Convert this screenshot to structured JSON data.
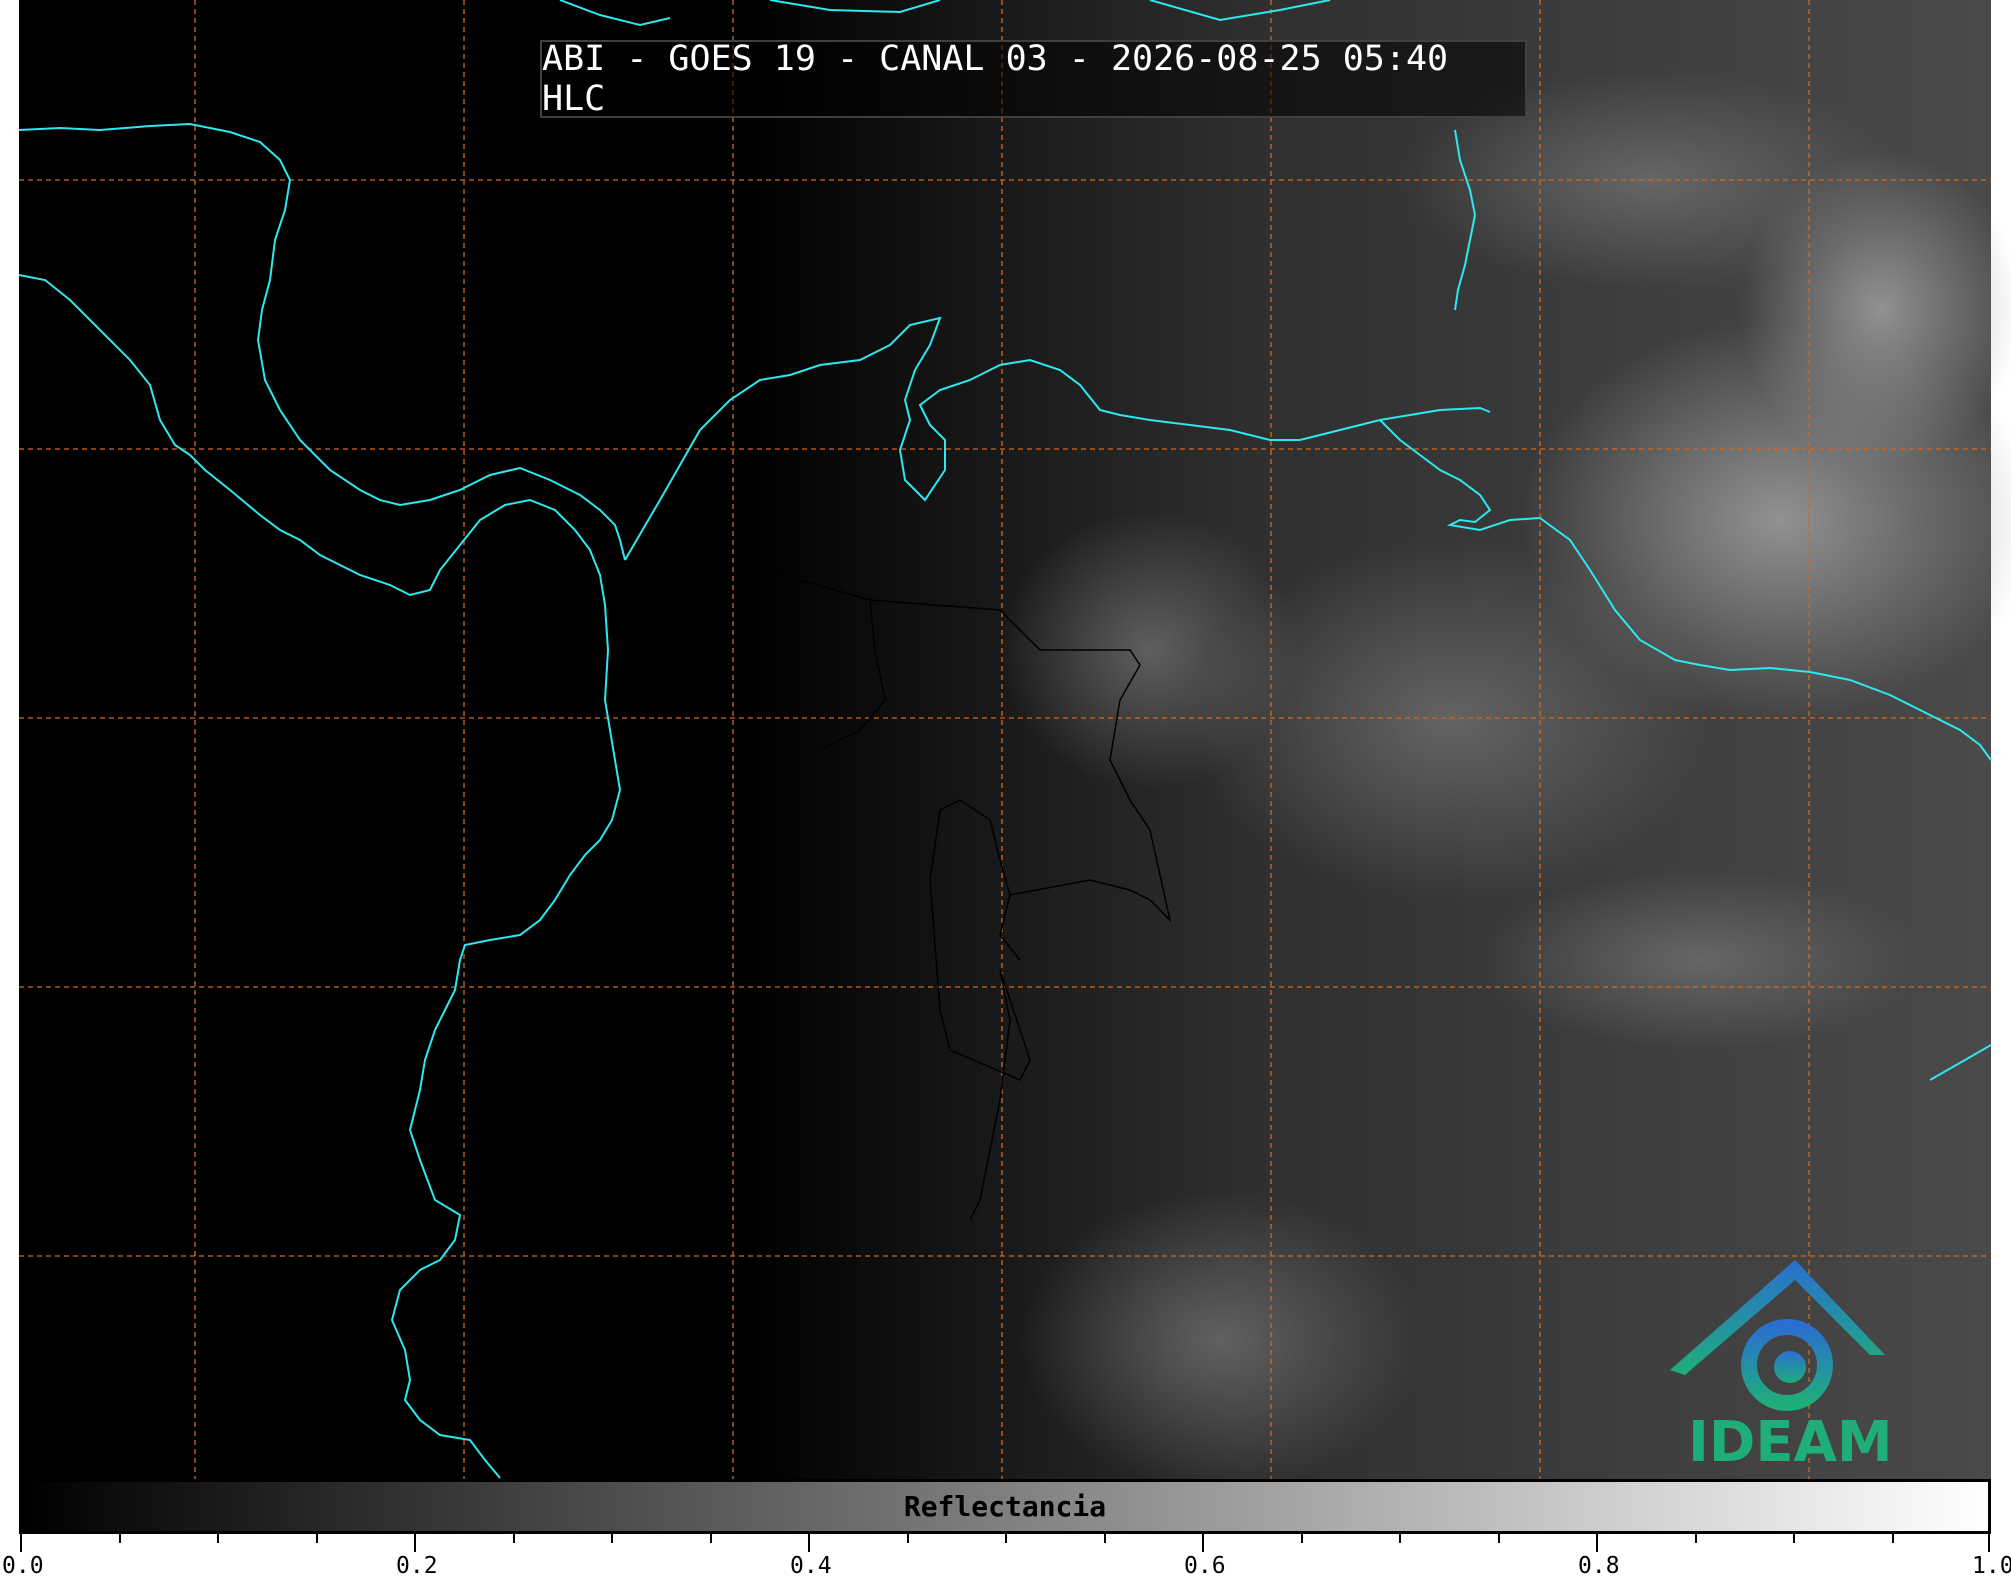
{
  "title": "ABI - GOES 19 - CANAL 03 - 2026-08-25 05:40 HLC",
  "colorbar": {
    "label": "Reflectancia",
    "ticks": [
      "0.0",
      "0.2",
      "0.4",
      "0.6",
      "0.8",
      "1.0"
    ],
    "range": [
      0.0,
      1.0
    ],
    "colors": [
      "#000000",
      "#ffffff"
    ]
  },
  "logo": {
    "text": "IDEAM",
    "colors": [
      "#2a6fd0",
      "#1fae7a"
    ]
  },
  "map": {
    "colors": {
      "coastline": "#2de8ee",
      "graticule": "#d2691e",
      "borders": "#000000"
    },
    "graticule": "dashed"
  }
}
